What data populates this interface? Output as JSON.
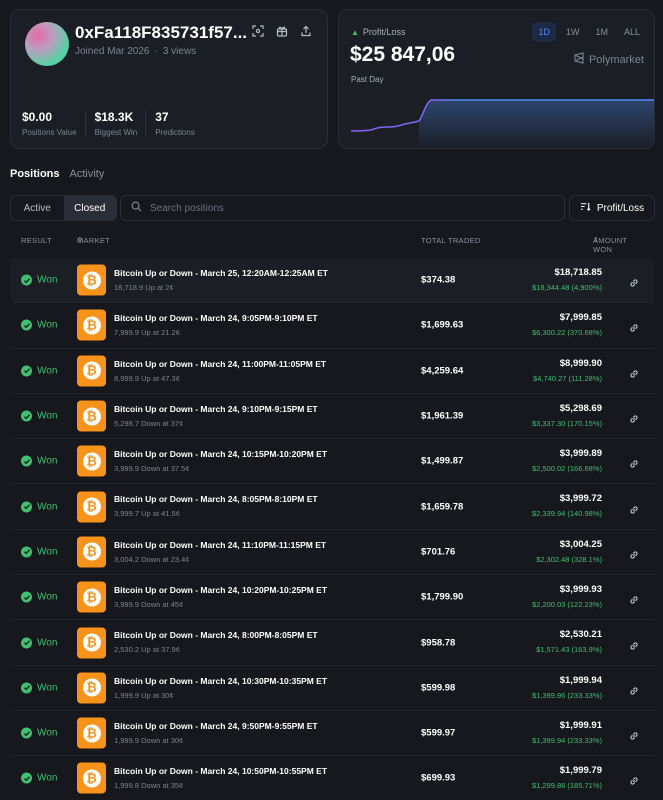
{
  "profile": {
    "name": "0xFa118F835731f57...",
    "joined": "Joined Mar 2026",
    "views": "3 views",
    "stats": [
      {
        "value": "$0.00",
        "label": "Positions Value"
      },
      {
        "value": "$18.3K",
        "label": "Biggest Win"
      },
      {
        "value": "37",
        "label": "Predictions"
      }
    ],
    "icons": [
      "scan-icon",
      "gift-icon",
      "share-icon"
    ]
  },
  "pnl": {
    "label": "Profit/Loss",
    "value": "$25 847,06",
    "period": "Past Day",
    "ranges": [
      "1D",
      "1W",
      "1M",
      "ALL"
    ],
    "active_range": "1D",
    "brand": "Polymarket",
    "colors": {
      "line_start": "#8a5cf6",
      "line_end": "#4e8cf5",
      "up": "#3fbf6f"
    }
  },
  "tabs": {
    "positions": "Positions",
    "activity": "Activity"
  },
  "filters": {
    "active": "Active",
    "closed": "Closed",
    "search_placeholder": "Search positions",
    "sort": "Profit/Loss"
  },
  "table": {
    "headers": {
      "result": "RESULT",
      "market": "MARKET",
      "total": "TOTAL TRADED",
      "amount": "AMOUNT WON"
    },
    "rows": [
      {
        "result": "Won",
        "title": "Bitcoin Up or Down - March 25, 12:20AM-12:25AM ET",
        "sub": "18,718.9 Up at 2¢",
        "total": "$374.38",
        "amount": "$18,718.85",
        "gain": "$18,344.48 (4,900%)"
      },
      {
        "result": "Won",
        "title": "Bitcoin Up or Down - March 24, 9:05PM-9:10PM ET",
        "sub": "7,999.9 Up at 21.2¢",
        "total": "$1,699.63",
        "amount": "$7,999.85",
        "gain": "$6,300.22 (370.68%)"
      },
      {
        "result": "Won",
        "title": "Bitcoin Up or Down - March 24, 11:00PM-11:05PM ET",
        "sub": "8,999.9 Up at 47.3¢",
        "total": "$4,259.64",
        "amount": "$8,999.90",
        "gain": "$4,740.27 (111.28%)"
      },
      {
        "result": "Won",
        "title": "Bitcoin Up or Down - March 24, 9:10PM-9:15PM ET",
        "sub": "5,298.7 Down at 37¢",
        "total": "$1,961.39",
        "amount": "$5,298.69",
        "gain": "$3,337.30 (170.15%)"
      },
      {
        "result": "Won",
        "title": "Bitcoin Up or Down - March 24, 10:15PM-10:20PM ET",
        "sub": "3,999.9 Down at 37.5¢",
        "total": "$1,499.87",
        "amount": "$3,999.89",
        "gain": "$2,500.02 (166.68%)"
      },
      {
        "result": "Won",
        "title": "Bitcoin Up or Down - March 24, 8:05PM-8:10PM ET",
        "sub": "3,999.7 Up at 41.5¢",
        "total": "$1,659.78",
        "amount": "$3,999.72",
        "gain": "$2,339.94 (140.98%)"
      },
      {
        "result": "Won",
        "title": "Bitcoin Up or Down - March 24, 11:10PM-11:15PM ET",
        "sub": "3,004.2 Down at 23.4¢",
        "total": "$701.76",
        "amount": "$3,004.25",
        "gain": "$2,302.48 (328.1%)"
      },
      {
        "result": "Won",
        "title": "Bitcoin Up or Down - March 24, 10:20PM-10:25PM ET",
        "sub": "3,999.9 Down at 45¢",
        "total": "$1,799.90",
        "amount": "$3,999.93",
        "gain": "$2,200.03 (122.23%)"
      },
      {
        "result": "Won",
        "title": "Bitcoin Up or Down - March 24, 8:00PM-8:05PM ET",
        "sub": "2,530.2 Up at 37.9¢",
        "total": "$958.78",
        "amount": "$2,530.21",
        "gain": "$1,571.43 (163.9%)"
      },
      {
        "result": "Won",
        "title": "Bitcoin Up or Down - March 24, 10:30PM-10:35PM ET",
        "sub": "1,999.9 Up at 30¢",
        "total": "$599.98",
        "amount": "$1,999.94",
        "gain": "$1,399.96 (233.33%)"
      },
      {
        "result": "Won",
        "title": "Bitcoin Up or Down - March 24, 9:50PM-9:55PM ET",
        "sub": "1,999.9 Down at 30¢",
        "total": "$599.97",
        "amount": "$1,999.91",
        "gain": "$1,399.94 (233.33%)"
      },
      {
        "result": "Won",
        "title": "Bitcoin Up or Down - March 24, 10:50PM-10:55PM ET",
        "sub": "1,999.8 Down at 35¢",
        "total": "$699.93",
        "amount": "$1,999.79",
        "gain": "$1,299.86 (185.71%)"
      }
    ]
  }
}
